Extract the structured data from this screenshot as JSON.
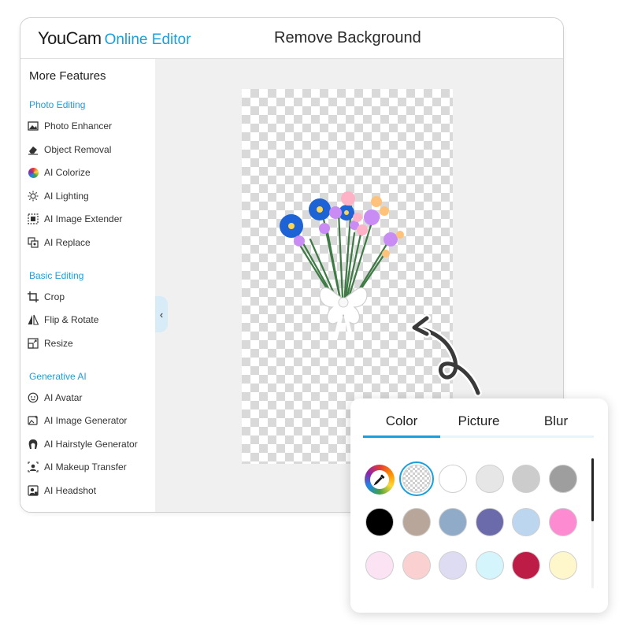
{
  "header": {
    "brand": "YouCam",
    "product": "Online Editor",
    "title": "Remove Background"
  },
  "sidebar": {
    "heading": "More Features",
    "sections": [
      {
        "title": "Photo Editing",
        "items": [
          {
            "label": "Photo Enhancer",
            "icon": "photo-enhancer-icon"
          },
          {
            "label": "Object Removal",
            "icon": "eraser-icon"
          },
          {
            "label": "AI Colorize",
            "icon": "colorize-icon"
          },
          {
            "label": "AI Lighting",
            "icon": "sun-icon"
          },
          {
            "label": "AI Image Extender",
            "icon": "extend-icon"
          },
          {
            "label": "AI Replace",
            "icon": "replace-icon"
          }
        ]
      },
      {
        "title": "Basic Editing",
        "items": [
          {
            "label": "Crop",
            "icon": "crop-icon"
          },
          {
            "label": "Flip & Rotate",
            "icon": "flip-icon"
          },
          {
            "label": "Resize",
            "icon": "resize-icon"
          }
        ]
      },
      {
        "title": "Generative AI",
        "items": [
          {
            "label": "AI Avatar",
            "icon": "smiley-icon"
          },
          {
            "label": "AI Image Generator",
            "icon": "image-generator-icon"
          },
          {
            "label": "AI Hairstyle Generator",
            "icon": "hairstyle-icon"
          },
          {
            "label": "AI Makeup Transfer",
            "icon": "makeup-icon"
          },
          {
            "label": "AI Headshot",
            "icon": "headshot-icon"
          }
        ]
      }
    ]
  },
  "background_panel": {
    "tabs": [
      "Color",
      "Picture",
      "Blur"
    ],
    "active_tab": "Color",
    "swatches": [
      [
        "picker",
        "transparent",
        "#ffffff",
        "#e6e6e6",
        "#cccccc",
        "#9e9e9e"
      ],
      [
        "#000000",
        "#b9a69a",
        "#8fabc7",
        "#6b6aaa",
        "#bcd6f0",
        "#fd8bd2"
      ],
      [
        "#fbe3f3",
        "#fbd0d0",
        "#dedcf3",
        "#d4f5fb",
        "#bd1c46",
        "#fef7cc"
      ]
    ],
    "selected_swatch": "transparent"
  },
  "colors": {
    "accent": "#1a9fdc",
    "canvas_bg": "#f0f0f0"
  }
}
